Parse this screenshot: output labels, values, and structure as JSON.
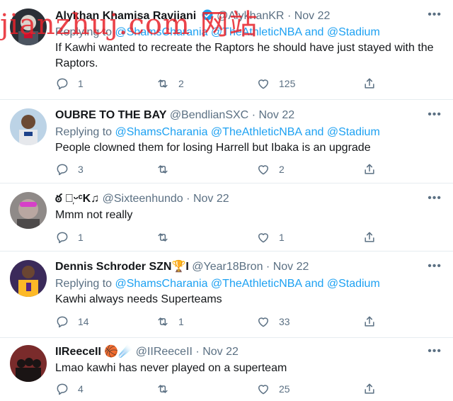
{
  "watermark": "jianzhuj.com 网站",
  "tweets": [
    {
      "name": "Alykhan Khamisa Ravjiani",
      "handle": "@AlykhanKR",
      "dot": "·",
      "date": "Nov 22",
      "verified": true,
      "replying_prefix": "Replying to",
      "mention1": "@ShamsCharania",
      "mention2": "@TheAthleticNBA",
      "and": "and",
      "mention3": "@Stadium",
      "text": "If Kawhi wanted to recreate the Raptors he should have just stayed with the Raptors.",
      "replies": "1",
      "retweets": "2",
      "likes": "125"
    },
    {
      "name": "OUBRE TO THE BAY",
      "handle": "@BendlianSXC",
      "dot": "·",
      "date": "Nov 22",
      "replying_prefix": "Replying to",
      "mention1": "@ShamsCharania",
      "mention2": "@TheAthleticNBA",
      "and": "and",
      "mention3": "@Stadium",
      "text": "People clowned them for losing Harrell but Ibaka is an upgrade",
      "replies": "3",
      "retweets": "",
      "likes": "2"
    },
    {
      "name": "ఠ ᑐ᷊ᵕᶜK♫",
      "handle": "@Sixteenhundo",
      "dot": "·",
      "date": "Nov 22",
      "text": "Mmm not really",
      "replies": "1",
      "retweets": "",
      "likes": "1"
    },
    {
      "name": "Dennis Schroder SZN🏆I",
      "handle": "@Year18Bron",
      "dot": "·",
      "date": "Nov 22",
      "replying_prefix": "Replying to",
      "mention1": "@ShamsCharania",
      "mention2": "@TheAthleticNBA",
      "and": "and",
      "mention3": "@Stadium",
      "text": "Kawhi always needs Superteams",
      "replies": "14",
      "retweets": "1",
      "likes": "33"
    },
    {
      "name": "IIReeceII",
      "emojis": "🏀☄️",
      "handle": "@IIReeceII",
      "dot": "·",
      "date": "Nov 22",
      "text": "Lmao kawhi has never played on a superteam",
      "replies": "4",
      "retweets": "",
      "likes": "25"
    }
  ],
  "icons": [
    "reply-icon",
    "retweet-icon",
    "like-icon",
    "share-icon",
    "more-icon",
    "verified-badge-icon"
  ],
  "colors": {
    "mention": "#1da1f2",
    "secondary_text": "#5b7083",
    "divider": "#e6ecf0",
    "watermark": "#e8232b"
  }
}
